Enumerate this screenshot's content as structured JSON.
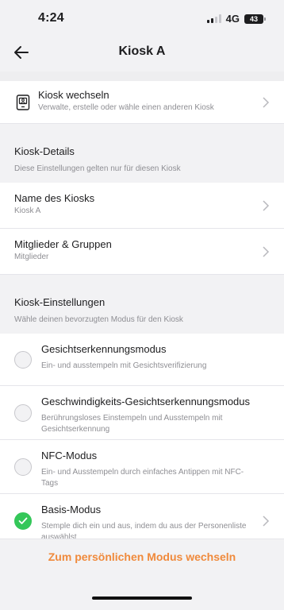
{
  "status_bar": {
    "time": "4:24",
    "network": "4G",
    "battery": "43"
  },
  "header": {
    "title": "Kiosk A"
  },
  "kiosk_switch": {
    "label": "Kiosk wechseln",
    "subtitle": "Verwalte, erstelle oder wähle einen anderen Kiosk"
  },
  "kiosk_details": {
    "heading": "Kiosk-Details",
    "subtitle": "Diese Einstellungen gelten nur für diesen Kiosk",
    "items": [
      {
        "label": "Name des Kiosks",
        "value": "Kiosk A"
      },
      {
        "label": "Mitglieder & Gruppen",
        "value": "Mitglieder"
      }
    ]
  },
  "kiosk_settings": {
    "heading": "Kiosk-Einstellungen",
    "subtitle": "Wähle deinen bevorzugten Modus für den Kiosk",
    "modes": [
      {
        "label": "Gesichtserkennungsmodus",
        "description": "Ein- und ausstempeln mit Gesichtsverifizierung",
        "selected": false
      },
      {
        "label": "Geschwindigkeits-Gesichtserkennungsmodus",
        "description": "Berührungsloses Einstempeln und Ausstempeln mit Gesichtserkennung",
        "selected": false
      },
      {
        "label": "NFC-Modus",
        "description": "Ein- und Ausstempeln durch einfaches Antippen mit NFC-Tags",
        "selected": false
      },
      {
        "label": "Basis-Modus",
        "description": "Stemple dich ein und aus, indem du aus der Personenliste auswählst",
        "selected": true
      }
    ]
  },
  "footer": {
    "switch_label": "Zum persönlichen Modus wechseln"
  },
  "colors": {
    "accent": "#f08a3c",
    "selected": "#34c759"
  }
}
